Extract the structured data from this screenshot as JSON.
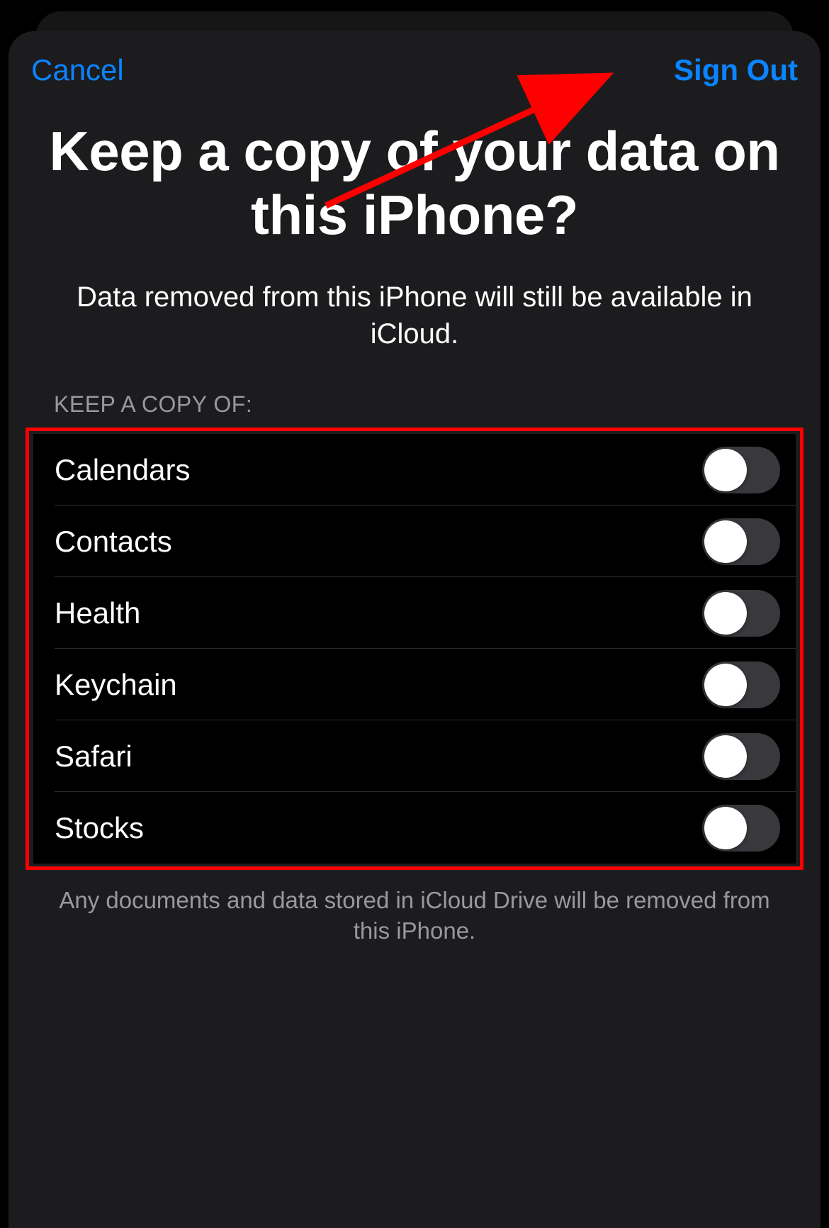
{
  "nav": {
    "cancel": "Cancel",
    "sign_out": "Sign Out"
  },
  "title": "Keep a copy of your data on this iPhone?",
  "subtitle": "Data removed from this iPhone will still be available in iCloud.",
  "section_header": "KEEP A COPY OF:",
  "items": [
    {
      "label": "Calendars",
      "on": false
    },
    {
      "label": "Contacts",
      "on": false
    },
    {
      "label": "Health",
      "on": false
    },
    {
      "label": "Keychain",
      "on": false
    },
    {
      "label": "Safari",
      "on": false
    },
    {
      "label": "Stocks",
      "on": false
    }
  ],
  "footer": "Any documents and data stored in iCloud Drive will be removed from this iPhone.",
  "annotation": {
    "highlight_color": "#ff0000",
    "arrow_target": "sign-out-button"
  }
}
